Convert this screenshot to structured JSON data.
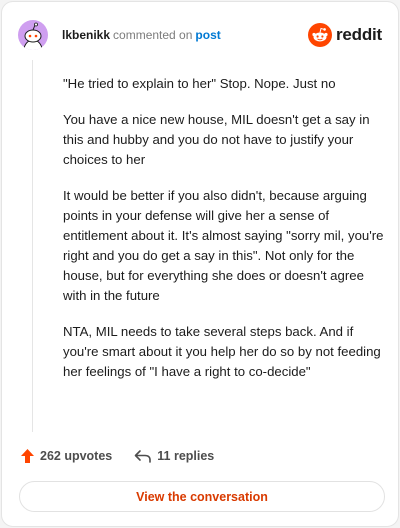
{
  "comment": {
    "username": "lkbenikk",
    "action_text": "commented on",
    "post_link_text": "post",
    "paragraphs": [
      "\"He tried to explain to her\" Stop. Nope. Just no",
      "You have a nice new house, MIL doesn't get a say in this and hubby and you do not have to justify your choices to her",
      "It would be better if you also didn't, because arguing points in your defense will give her a sense of entitlement about it. It's almost saying \"sorry mil, you're right and you do get a say in this\". Not only for the house, but for everything she does or doesn't agree with in the future",
      "NTA, MIL needs to take several steps back. And if you're smart about it you help her do so by not feeding her feelings of \"I have a right to co-decide\""
    ]
  },
  "brand": {
    "name": "reddit"
  },
  "stats": {
    "upvotes": "262 upvotes",
    "replies": "11 replies"
  },
  "cta": {
    "label": "View the conversation"
  },
  "icons": {
    "avatar": "snoo-avatar-icon",
    "logo": "reddit-logo-icon",
    "upvote": "upvote-arrow-icon",
    "reply": "reply-arrow-icon"
  },
  "colors": {
    "accent": "#d93a00",
    "upvote": "#ff4500",
    "link": "#0079d3",
    "avatar_bg": "#cf9ff0"
  }
}
